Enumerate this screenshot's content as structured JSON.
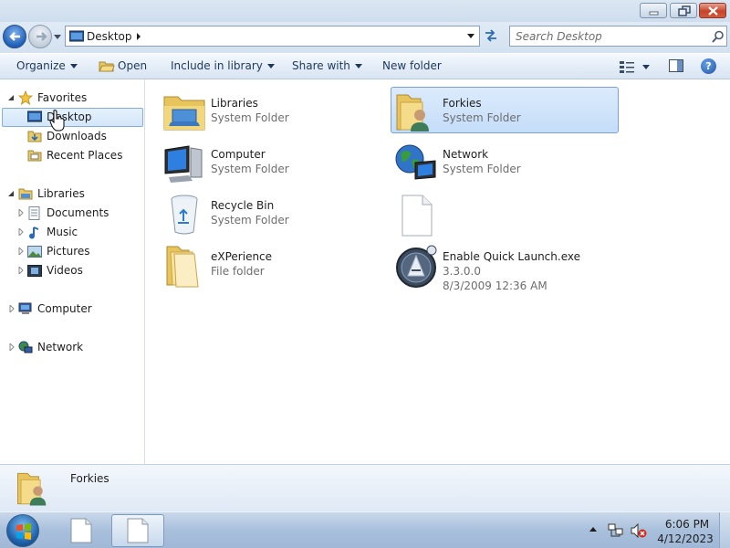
{
  "window": {
    "address": {
      "location": "Desktop"
    },
    "search": {
      "placeholder": "Search Desktop"
    }
  },
  "toolbar": {
    "organize": "Organize",
    "open": "Open",
    "include_in_library": "Include in library",
    "share_with": "Share with",
    "new_folder": "New folder",
    "help": "?"
  },
  "nav": {
    "favorites": "Favorites",
    "desktop": "Desktop",
    "downloads": "Downloads",
    "recent_places": "Recent Places",
    "libraries": "Libraries",
    "documents": "Documents",
    "music": "Music",
    "pictures": "Pictures",
    "videos": "Videos",
    "computer": "Computer",
    "network": "Network"
  },
  "items": [
    {
      "name": "Libraries",
      "sub": "System Folder",
      "icon": "libraries-icon"
    },
    {
      "name": "Forkies",
      "sub": "System Folder",
      "icon": "user-folder-icon",
      "selected": true
    },
    {
      "name": "Computer",
      "sub": "System Folder",
      "icon": "computer-icon"
    },
    {
      "name": "Network",
      "sub": "System Folder",
      "icon": "network-icon"
    },
    {
      "name": "Recycle Bin",
      "sub": "System Folder",
      "icon": "recycle-bin-icon"
    },
    {
      "name": "",
      "sub": "",
      "icon": "blank-file-icon"
    },
    {
      "name": "eXPerience",
      "sub": "File folder",
      "icon": "folder-icon"
    },
    {
      "name": "Enable Quick Launch.exe",
      "sub": "3.3.0.0",
      "sub2": "8/3/2009 12:36 AM",
      "icon": "exe-icon"
    }
  ],
  "details": {
    "name": "Forkies"
  },
  "taskbar": {
    "time": "6:06 PM",
    "date": "4/12/2023"
  },
  "colors": {
    "selection": "#cfe3fb",
    "selection_border": "#7da2ce",
    "link_text": "#1e395b"
  }
}
